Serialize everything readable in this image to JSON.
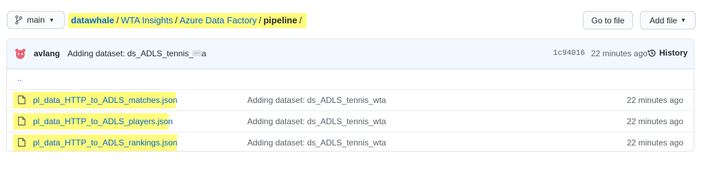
{
  "branch": {
    "label": "main"
  },
  "breadcrumb": {
    "owner": "datawhale",
    "parts": [
      "WTA Insights",
      "Azure Data Factory"
    ],
    "current": "pipeline",
    "separator": "/"
  },
  "actions": {
    "goto_file": "Go to file",
    "add_file": "Add file"
  },
  "commit": {
    "author": "avlang",
    "message": "Adding dataset: ds_ADLS_tennis_wta",
    "ellipsis": "…",
    "sha": "1c94016",
    "time": "22 minutes ago",
    "history_label": "History"
  },
  "parent_dir": "..",
  "files": [
    {
      "name": "pl_data_HTTP_to_ADLS_matches.json",
      "message": "Adding dataset: ds_ADLS_tennis_wta",
      "time": "22 minutes ago"
    },
    {
      "name": "pl_data_HTTP_to_ADLS_players.json",
      "message": "Adding dataset: ds_ADLS_tennis_wta",
      "time": "22 minutes ago"
    },
    {
      "name": "pl_data_HTTP_to_ADLS_rankings.json",
      "message": "Adding dataset: ds_ADLS_tennis_wta",
      "time": "22 minutes ago"
    }
  ],
  "colors": {
    "highlight": "#fffb7d",
    "link": "#0366d6",
    "commit_bg": "#f1f8ff",
    "avatar": "#e8647a"
  }
}
